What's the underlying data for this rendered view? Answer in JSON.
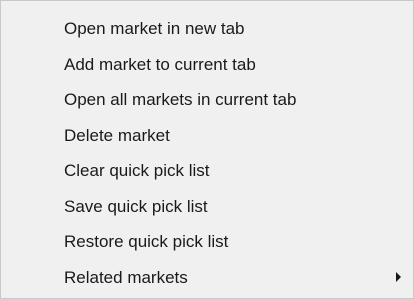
{
  "menu": {
    "items": [
      {
        "label": "Open market in new tab"
      },
      {
        "label": "Add market to current tab"
      },
      {
        "label": "Open all markets in current tab"
      },
      {
        "label": "Delete market"
      },
      {
        "label": "Clear quick pick list"
      },
      {
        "label": "Save quick pick list"
      },
      {
        "label": "Restore quick pick list"
      },
      {
        "label": "Related markets",
        "has_submenu": true,
        "icon": "chevron-right-icon"
      }
    ]
  },
  "colors": {
    "background": "#f0f0f0",
    "text": "#1a1a1a",
    "border": "#c8c8c8"
  }
}
